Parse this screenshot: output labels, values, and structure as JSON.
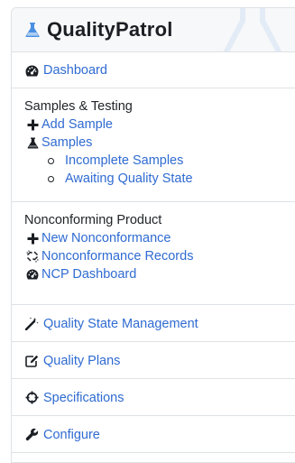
{
  "brand": {
    "title": "QualityPatrol",
    "icon": "flask-icon",
    "accent": "#4a90e2"
  },
  "nav": {
    "dashboard": {
      "label": "Dashboard",
      "icon": "tachometer-icon"
    },
    "samples_section": {
      "heading": "Samples & Testing",
      "items": [
        {
          "label": "Add Sample",
          "icon": "plus-icon"
        },
        {
          "label": "Samples",
          "icon": "flask-icon"
        }
      ],
      "sub_items": [
        {
          "label": "Incomplete Samples",
          "icon": "circle-bullet-icon"
        },
        {
          "label": "Awaiting Quality State",
          "icon": "circle-bullet-icon"
        }
      ]
    },
    "ncp_section": {
      "heading": "Nonconforming Product",
      "items": [
        {
          "label": "New Nonconformance",
          "icon": "plus-icon"
        },
        {
          "label": "Nonconformance Records",
          "icon": "unlink-icon"
        },
        {
          "label": "NCP Dashboard",
          "icon": "tachometer-icon"
        }
      ]
    },
    "quality_state": {
      "label": "Quality State Management",
      "icon": "magic-wand-icon"
    },
    "quality_plans": {
      "label": "Quality Plans",
      "icon": "edit-icon"
    },
    "specifications": {
      "label": "Specifications",
      "icon": "crosshairs-icon"
    },
    "configure": {
      "label": "Configure",
      "icon": "wrench-icon"
    }
  },
  "colors": {
    "link": "#2f6bd1",
    "text": "#212529",
    "border": "#dee2e6",
    "brand_bg": "#f7f8f9"
  }
}
